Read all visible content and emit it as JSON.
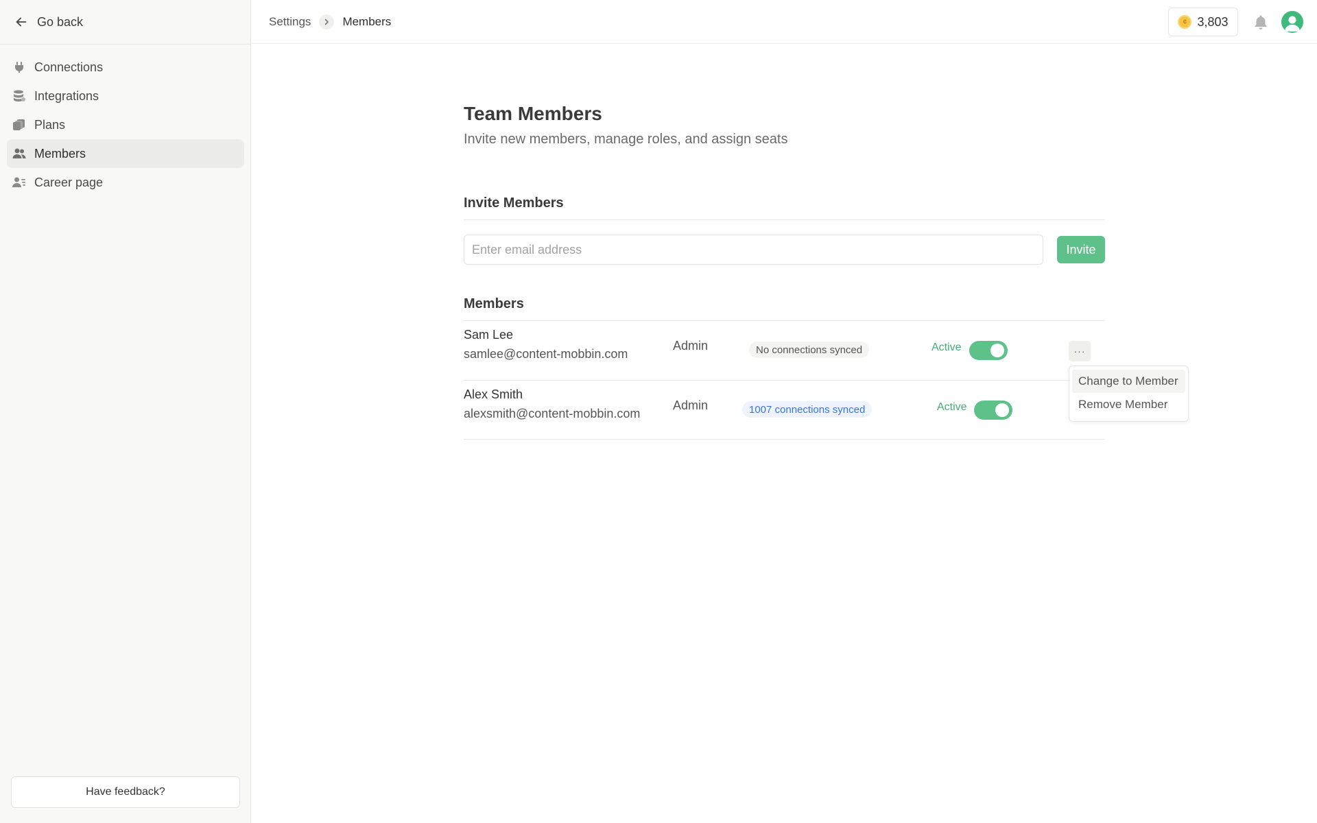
{
  "sidebar": {
    "go_back": "Go back",
    "items": [
      {
        "label": "Connections",
        "icon": "plug-icon"
      },
      {
        "label": "Integrations",
        "icon": "database-icon"
      },
      {
        "label": "Plans",
        "icon": "plans-icon"
      },
      {
        "label": "Members",
        "icon": "users-icon",
        "active": true
      },
      {
        "label": "Career page",
        "icon": "career-icon"
      }
    ],
    "feedback": "Have feedback?"
  },
  "topbar": {
    "breadcrumb": [
      "Settings",
      "Members"
    ],
    "credits": "3,803"
  },
  "page": {
    "title": "Team Members",
    "subtitle": "Invite new members, manage roles, and assign seats"
  },
  "invite": {
    "heading": "Invite Members",
    "placeholder": "Enter email address",
    "button": "Invite"
  },
  "members": {
    "heading": "Members",
    "rows": [
      {
        "name": "Sam Lee",
        "email": "samlee@content-mobbin.com",
        "role": "Admin",
        "sync": "No connections synced",
        "status": "Active",
        "enabled": true
      },
      {
        "name": "Alex Smith",
        "email": "alexsmith@content-mobbin.com",
        "role": "Admin",
        "sync": "1007 connections synced",
        "status": "Active",
        "enabled": true
      }
    ]
  },
  "menu": {
    "more": "···",
    "items": [
      "Change to Member",
      "Remove Member"
    ]
  },
  "colors": {
    "accent": "#5ec18a",
    "link": "#3b74e0"
  }
}
